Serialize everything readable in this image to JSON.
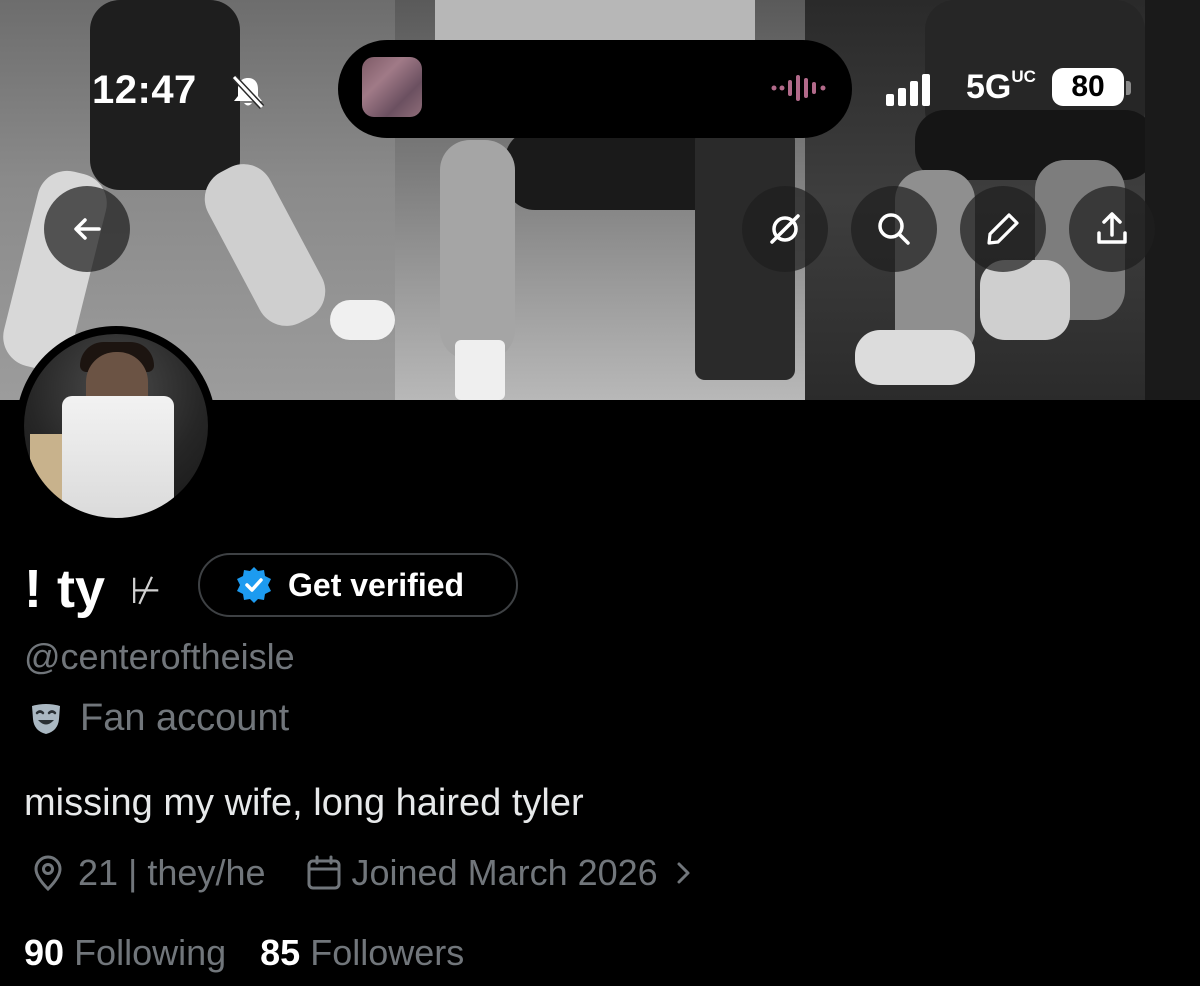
{
  "status_bar": {
    "time": "12:47",
    "network": "5G",
    "network_sup": "UC",
    "battery": "80"
  },
  "header_buttons": [
    "back-arrow-icon",
    "grok-icon",
    "search-icon",
    "edit-pencil-icon",
    "share-upload-icon"
  ],
  "profile": {
    "name": "! ty",
    "name_symbol": "⊬",
    "verify_label": "Get verified",
    "handle": "@centeroftheisle",
    "category": "Fan account",
    "bio": "missing my wife, long haired tyler",
    "location": "21 | they/he",
    "joined": "Joined March 2026",
    "following_count": "90",
    "following_label": "Following",
    "followers_count": "85",
    "followers_label": "Followers"
  },
  "colors": {
    "background": "#000000",
    "muted_text": "#71767b",
    "verified_blue": "#1d9bf0"
  }
}
